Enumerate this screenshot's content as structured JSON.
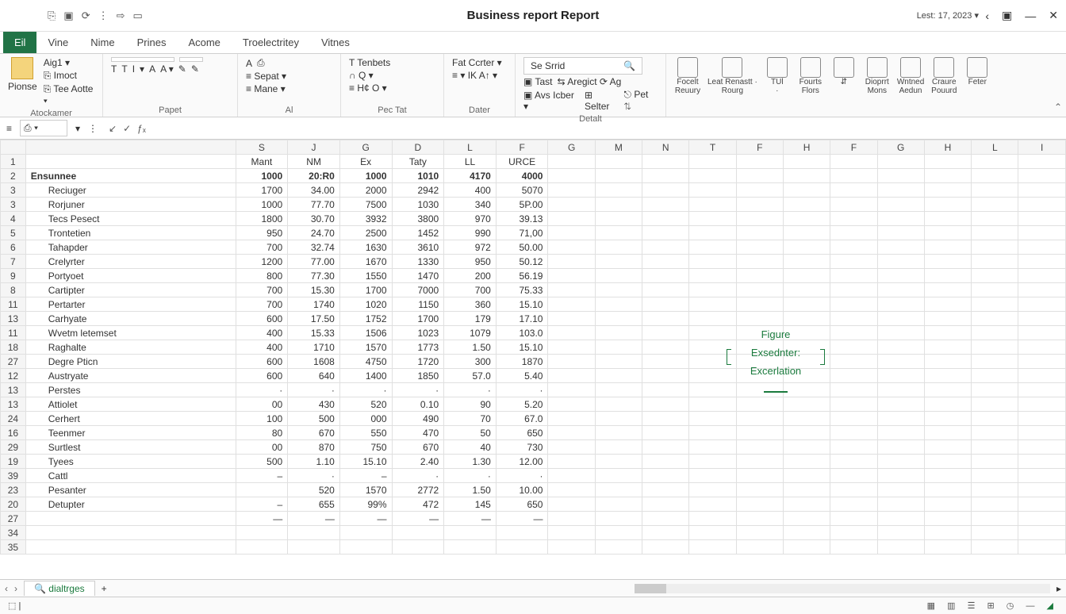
{
  "title": "Business report Report",
  "last_modified": "Lest: 17, 2023 ▾",
  "qat": [
    "⎘",
    "▣",
    "⟳",
    "⋮",
    "⇨",
    "▭"
  ],
  "win": {
    "back": "‹",
    "panel": "▣",
    "min": "—",
    "close": "✕"
  },
  "tabs": [
    "Eil",
    "Vine",
    "Nime",
    "Prines",
    "Acome",
    "Troelectritey",
    "Vitnes"
  ],
  "ribbon": {
    "clipboard": {
      "paste": "Pionse",
      "name": "Aig1 ▾",
      "imoct": "⎘ Imoct",
      "toe": "⎘ Tee Aotte ▾",
      "label": "Atockamer"
    },
    "font": {
      "box": "",
      "bold": "T",
      "italic": "T",
      "under": "I",
      "strike": "▾",
      "fill": "A",
      "fontcolor": "A ▾",
      "clear": "✎",
      "brush": "✎",
      "label": "Papet"
    },
    "align": {
      "a": "A",
      "aa": "⎙",
      "sepat": "≡ Sepat ▾",
      "tenbets": "T Tenbets",
      "mane": "≡ Mane ▾",
      "q": "∩  Q  ▾",
      "hc": "≡ H¢ O ▾",
      "label": "Al"
    },
    "number": {
      "fat": "Fat Ccrter ▾",
      "row": "≡ ▾   IK  A↑ ▾",
      "label": "Pec Tat"
    },
    "styles": {
      "search": "Se Srrid",
      "test": "▣ Tast",
      "aregict": "⇆ Aregict  ⟳ Ag",
      "avs": "▣ Avs Icber ▾",
      "selter": "⊞ Selter",
      "pet": "⎋ Pet  ⇅",
      "label": "Detalt"
    },
    "date_label": "Dater",
    "tools": [
      {
        "l1": "Focelt",
        "l2": "Reuury"
      },
      {
        "l1": "Leat Renastt ·",
        "l2": "Rourg"
      },
      {
        "l1": "TUl",
        "l2": "·"
      },
      {
        "l1": "Fourts",
        "l2": "Flors"
      },
      {
        "l1": "⇵",
        "": ""
      },
      {
        "l1": "Dioprrt",
        "l2": "Mons"
      },
      {
        "l1": "Wntned",
        "l2": "Aedun"
      },
      {
        "l1": "Craure",
        "l2": "Pouurd"
      },
      {
        "l1": "Feter",
        "l2": ""
      }
    ]
  },
  "columns_letters": [
    "S",
    "J",
    "G",
    "D",
    "L",
    "F",
    "G",
    "M",
    "N",
    "T",
    "F",
    "H",
    "F",
    "G",
    "H",
    "L",
    "I"
  ],
  "headers": [
    "Mant",
    "NM",
    "Ex",
    "Taty",
    "LL",
    "URCE"
  ],
  "row_numbers": [
    "1",
    "2",
    "3",
    "3",
    "4",
    "5",
    "6",
    "7",
    "9",
    "8",
    "11",
    "13",
    "11",
    "18",
    "27",
    "12",
    "13",
    "13",
    "24",
    "16",
    "29",
    "19",
    "39",
    "23",
    "20",
    "27",
    "34",
    "35"
  ],
  "rows": [
    {
      "label": "",
      "vals": [
        "Mant",
        "NM",
        "Ex",
        "Taty",
        "LL",
        "URCE"
      ],
      "hdr": true
    },
    {
      "label": "Ensunnee",
      "vals": [
        "1000",
        "20:R0",
        "1000",
        "1010",
        "4170",
        "4000"
      ],
      "bold": true
    },
    {
      "label": "Reciuger",
      "vals": [
        "1700",
        "34.00",
        "2000",
        "2942",
        "400",
        "5070"
      ],
      "indent": true
    },
    {
      "label": "Rorjuner",
      "vals": [
        "1000",
        "77.70",
        "7500",
        "1030",
        "340",
        "5P.00"
      ],
      "indent": true
    },
    {
      "label": "Tecs Pesect",
      "vals": [
        "1800",
        "30.70",
        "3932",
        "3800",
        "970",
        "39.13"
      ],
      "indent": true
    },
    {
      "label": "Trontetien",
      "vals": [
        "950",
        "24.70",
        "2500",
        "1452",
        "990",
        "71,00"
      ],
      "indent": true
    },
    {
      "label": "Tahapder",
      "vals": [
        "700",
        "32.74",
        "1630",
        "3610",
        "972",
        "50.00"
      ],
      "indent": true
    },
    {
      "label": "Crelyrter",
      "vals": [
        "1200",
        "77.00",
        "1670",
        "1330",
        "950",
        "50.12"
      ],
      "indent": true
    },
    {
      "label": "Portyoet",
      "vals": [
        "800",
        "77.30",
        "1550",
        "1470",
        "200",
        "56.19"
      ],
      "indent": true
    },
    {
      "label": "Cartipter",
      "vals": [
        "700",
        "15.30",
        "1700",
        "7000",
        "700",
        "75.33"
      ],
      "indent": true
    },
    {
      "label": "Pertarter",
      "vals": [
        "700",
        "1740",
        "1020",
        "1150",
        "360",
        "15.10"
      ],
      "indent": true
    },
    {
      "label": "Carhyate",
      "vals": [
        "600",
        "17.50",
        "1752",
        "1700",
        "179",
        "17.10"
      ],
      "indent": true
    },
    {
      "label": "Wvetm letemset",
      "vals": [
        "400",
        "15.33",
        "1506",
        "1023",
        "1079",
        "103.0"
      ],
      "indent": true
    },
    {
      "label": "Raghalte",
      "vals": [
        "400",
        "1710",
        "1570",
        "1773",
        "1.50",
        "15.10"
      ],
      "indent": true
    },
    {
      "label": "Degre Pticn",
      "vals": [
        "600",
        "1608",
        "4750",
        "1720",
        "300",
        "1870"
      ],
      "indent": true
    },
    {
      "label": "Austryate",
      "vals": [
        "600",
        "640",
        "1400",
        "1850",
        "57.0",
        "5.40"
      ],
      "indent": true
    },
    {
      "label": "Perstes",
      "vals": [
        "·",
        "·",
        "·",
        "·",
        "·",
        "·"
      ],
      "indent": true
    },
    {
      "label": "Attiolet",
      "vals": [
        "00",
        "430",
        "520",
        "0.10",
        "90",
        "5.20"
      ],
      "indent": true
    },
    {
      "label": "Cerhert",
      "vals": [
        "100",
        "500",
        "000",
        "490",
        "70",
        "67.0"
      ],
      "indent": true
    },
    {
      "label": "Teenmer",
      "vals": [
        "80",
        "670",
        "550",
        "470",
        "50",
        "650"
      ],
      "indent": true
    },
    {
      "label": "Surtlest",
      "vals": [
        "00",
        "870",
        "750",
        "670",
        "40",
        "730"
      ],
      "indent": true
    },
    {
      "label": "Tyees",
      "vals": [
        "500",
        "1.10",
        "15.10",
        "2.40",
        "1.30",
        "12.00"
      ],
      "indent": true
    },
    {
      "label": "Cattl",
      "vals": [
        "–",
        "·",
        "–",
        "·",
        "·",
        "·"
      ],
      "indent": true
    },
    {
      "label": "Pesanter",
      "vals": [
        "",
        "520",
        "1570",
        "2772",
        "1.50",
        "10.00"
      ],
      "indent": true
    },
    {
      "label": "Detupter",
      "vals": [
        "–",
        "655",
        "99%",
        "472",
        "145",
        "650"
      ],
      "indent": true
    },
    {
      "label": "",
      "vals": [
        "—",
        "—",
        "—",
        "—",
        "—",
        "—"
      ],
      "indent": true
    },
    {
      "label": "",
      "vals": [
        "",
        "",
        "",
        "",
        "",
        ""
      ]
    },
    {
      "label": "",
      "vals": [
        "",
        "",
        "",
        "",
        "",
        ""
      ]
    }
  ],
  "figure": {
    "t1": "Figure",
    "t2": "Exsednter:",
    "t3": "Excerlation"
  },
  "sheet": {
    "name": "dialtrges",
    "plus": "+"
  },
  "status": {
    "left": "⬚  |",
    "views": [
      "▦",
      "▥",
      "☰",
      "⊞",
      "◷"
    ]
  }
}
